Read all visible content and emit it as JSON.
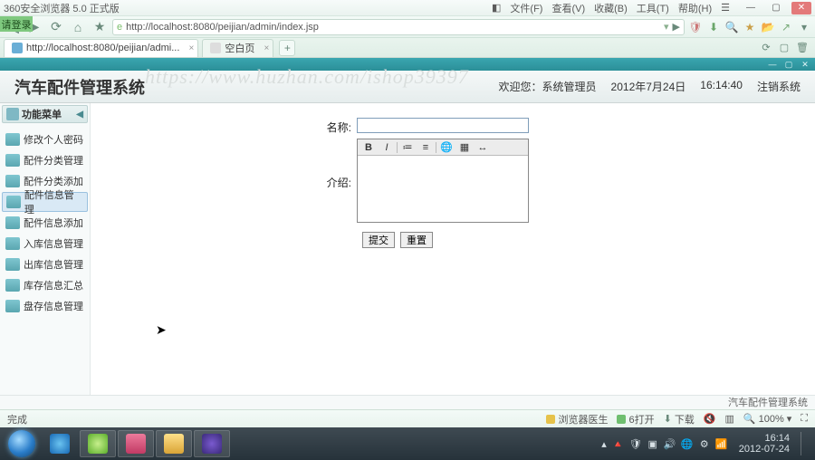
{
  "browser": {
    "title": "360安全浏览器 5.0 正式版",
    "badge_text": "请登录",
    "menus": [
      "文件(F)",
      "查看(V)",
      "收藏(B)",
      "工具(T)",
      "帮助(H)"
    ],
    "url": "http://localhost:8080/peijian/admin/index.jsp",
    "tabs": [
      {
        "label": "http://localhost:8080/peijian/admi...",
        "active": true
      },
      {
        "label": "空白页",
        "active": false
      }
    ]
  },
  "watermark": "https://www.huzhan.com/ishop39397",
  "app": {
    "title": "汽车配件管理系统",
    "welcome_label": "欢迎您：",
    "user": "系统管理员",
    "date": "2012年7月24日",
    "time": "16:14:40",
    "logout": "注销系统",
    "footer": "汽车配件管理系统"
  },
  "sidebar": {
    "header": "功能菜单",
    "items": [
      {
        "label": "修改个人密码"
      },
      {
        "label": "配件分类管理"
      },
      {
        "label": "配件分类添加"
      },
      {
        "label": "配件信息管理"
      },
      {
        "label": "配件信息添加"
      },
      {
        "label": "入库信息管理"
      },
      {
        "label": "出库信息管理"
      },
      {
        "label": "库存信息汇总"
      },
      {
        "label": "盘存信息管理"
      }
    ],
    "selected_index": 3
  },
  "form": {
    "name_label": "名称:",
    "intro_label": "介绍:",
    "name_value": "",
    "intro_value": "",
    "submit": "提交",
    "reset": "重置"
  },
  "rte_buttons": [
    "B",
    "I",
    "sep",
    "≔",
    "≡",
    "sep",
    "🌐",
    "▦",
    "↔"
  ],
  "status": {
    "done": "完成",
    "doctor": "浏览器医生",
    "kaiwan": "6打开",
    "download": "下载",
    "zoom": "100%"
  },
  "taskbar": {
    "clock_time": "16:14",
    "clock_date": "2012-07-24"
  }
}
